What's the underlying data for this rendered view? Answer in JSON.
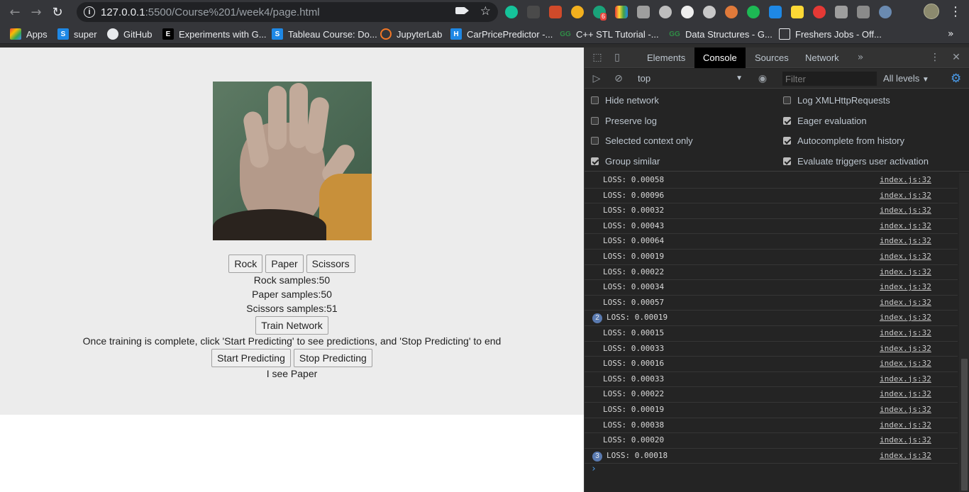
{
  "browser": {
    "url_host": "127.0.0.1",
    "url_rest": ":5500/Course%201/week4/page.html",
    "extension_badge": "6",
    "bookmarks": [
      {
        "label": "Apps",
        "icon": "apps-grid-icon"
      },
      {
        "label": "super",
        "icon": "s-icon"
      },
      {
        "label": "GitHub",
        "icon": "github-icon"
      },
      {
        "label": "Experiments with G...",
        "icon": "e-icon"
      },
      {
        "label": "Tableau Course: Do...",
        "icon": "s-icon"
      },
      {
        "label": "JupyterLab",
        "icon": "jupyter-icon"
      },
      {
        "label": "CarPricePredictor -...",
        "icon": "heroku-icon"
      },
      {
        "label": "C++ STL Tutorial -...",
        "icon": "geeksforgeeks-icon"
      },
      {
        "label": "Data Structures - G...",
        "icon": "geeksforgeeks-icon"
      },
      {
        "label": "Freshers Jobs - Off...",
        "icon": "page-icon"
      }
    ]
  },
  "app": {
    "buttons_row1": [
      "Rock",
      "Paper",
      "Scissors"
    ],
    "rock_samples": "Rock samples:50",
    "paper_samples": "Paper samples:50",
    "scissors_samples": "Scissors samples:51",
    "train_label": "Train Network",
    "instructions": "Once training is complete, click 'Start Predicting' to see predictions, and 'Stop Predicting' to end",
    "start_label": "Start Predicting",
    "stop_label": "Stop Predicting",
    "prediction": "I see Paper"
  },
  "devtools": {
    "tabs": [
      "Elements",
      "Console",
      "Sources",
      "Network"
    ],
    "active_tab": "Console",
    "context": "top",
    "filter_placeholder": "Filter",
    "levels": "All levels",
    "settings_left": [
      {
        "label": "Hide network",
        "checked": false
      },
      {
        "label": "Preserve log",
        "checked": false
      },
      {
        "label": "Selected context only",
        "checked": false
      },
      {
        "label": "Group similar",
        "checked": true
      }
    ],
    "settings_right": [
      {
        "label": "Log XMLHttpRequests",
        "checked": false
      },
      {
        "label": "Eager evaluation",
        "checked": true
      },
      {
        "label": "Autocomplete from history",
        "checked": true
      },
      {
        "label": "Evaluate triggers user activation",
        "checked": true
      }
    ],
    "logs": [
      {
        "msg": "LOSS: 0.00058",
        "src": "index.js:32"
      },
      {
        "msg": "LOSS: 0.00096",
        "src": "index.js:32"
      },
      {
        "msg": "LOSS: 0.00032",
        "src": "index.js:32"
      },
      {
        "msg": "LOSS: 0.00043",
        "src": "index.js:32"
      },
      {
        "msg": "LOSS: 0.00064",
        "src": "index.js:32"
      },
      {
        "msg": "LOSS: 0.00019",
        "src": "index.js:32"
      },
      {
        "msg": "LOSS: 0.00022",
        "src": "index.js:32"
      },
      {
        "msg": "LOSS: 0.00034",
        "src": "index.js:32"
      },
      {
        "msg": "LOSS: 0.00057",
        "src": "index.js:32"
      },
      {
        "msg": "LOSS: 0.00019",
        "src": "index.js:32",
        "count": "2"
      },
      {
        "msg": "LOSS: 0.00015",
        "src": "index.js:32"
      },
      {
        "msg": "LOSS: 0.00033",
        "src": "index.js:32"
      },
      {
        "msg": "LOSS: 0.00016",
        "src": "index.js:32"
      },
      {
        "msg": "LOSS: 0.00033",
        "src": "index.js:32"
      },
      {
        "msg": "LOSS: 0.00022",
        "src": "index.js:32"
      },
      {
        "msg": "LOSS: 0.00019",
        "src": "index.js:32"
      },
      {
        "msg": "LOSS: 0.00038",
        "src": "index.js:32"
      },
      {
        "msg": "LOSS: 0.00020",
        "src": "index.js:32"
      },
      {
        "msg": "LOSS: 0.00018",
        "src": "index.js:32",
        "count": "3"
      }
    ],
    "prompt": "›"
  }
}
